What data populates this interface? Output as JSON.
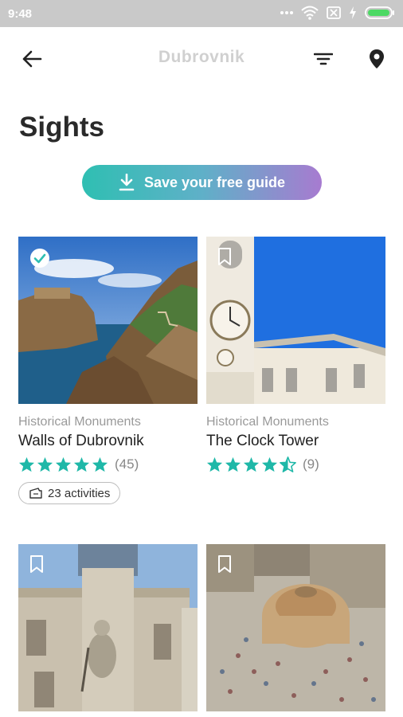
{
  "status_bar": {
    "time": "9:48",
    "icons": [
      "dots-icon",
      "wifi-icon",
      "sim-off-icon",
      "charging-icon",
      "battery-icon"
    ]
  },
  "app_bar": {
    "title": "Dubrovnik",
    "back_icon": "arrow-left-icon",
    "filter_icon": "filter-icon",
    "location_icon": "location-pin-icon"
  },
  "page_title": "Sights",
  "save_button": {
    "label": "Save your free guide",
    "icon": "download-icon"
  },
  "colors": {
    "accent_teal": "#2fbfb2",
    "accent_purple": "#a77bd0",
    "star": "#1fb8a8"
  },
  "cards": [
    {
      "category": "Historical Monuments",
      "name": "Walls of Dubrovnik",
      "rating": 5,
      "rating_count": "(45)",
      "activities": "23 activities",
      "saved": true
    },
    {
      "category": "Historical Monuments",
      "name": "The Clock Tower",
      "rating": 4.5,
      "rating_count": "(9)",
      "saved": false
    },
    {
      "saved": false
    },
    {
      "saved": false
    }
  ]
}
